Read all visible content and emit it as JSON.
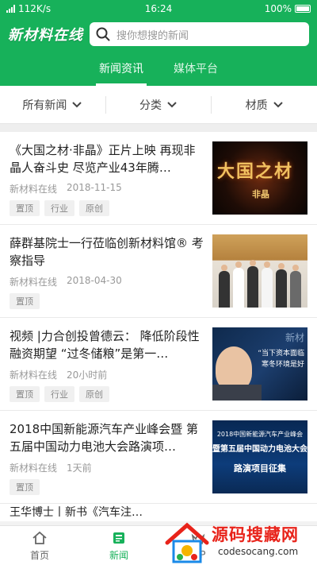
{
  "status": {
    "left": "112K/s",
    "time": "16:24",
    "battery": "100%"
  },
  "header": {
    "logo": "新材料在线",
    "search_placeholder": "搜你想搜的新闻"
  },
  "tabs": [
    {
      "label": "新闻资讯",
      "active": true
    },
    {
      "label": "媒体平台",
      "active": false
    }
  ],
  "filters": [
    {
      "label": "所有新闻"
    },
    {
      "label": "分类"
    },
    {
      "label": "材质"
    }
  ],
  "articles": [
    {
      "title": "《大国之材·非晶》正片上映 再现非晶人奋斗史 尽览产业43年腾…",
      "source": "新材料在线",
      "date": "2018-11-15",
      "tags": [
        "置顶",
        "行业",
        "原创"
      ],
      "thumb": {
        "big": "大国之材",
        "small": "非晶"
      }
    },
    {
      "title": "薛群基院士一行莅临创新材料馆® 考察指导",
      "source": "新材料在线",
      "date": "2018-04-30",
      "tags": [
        "置顶"
      ]
    },
    {
      "title": "视频 |力合创投曾德云：  降低阶段性融资期望 “过冬储粮”是第一…",
      "source": "新材料在线",
      "date": "20小时前",
      "tags": [
        "置顶",
        "行业",
        "原创"
      ],
      "thumb": {
        "wm": "新材",
        "cap1": "“当下资本面临",
        "cap2": "寒冬环境是好"
      }
    },
    {
      "title": "2018中国新能源汽车产业峰会暨 第五届中国动力电池大会路演项…",
      "source": "新材料在线",
      "date": "1天前",
      "tags": [
        "置顶"
      ],
      "thumb": {
        "l1": "2018中国新能源汽车产业峰会",
        "l2": "暨第五届中国动力电池大会",
        "l3": "路演项目征集"
      }
    }
  ],
  "partial_title": "王华博士丨新书《汽车注…",
  "bottom_nav": [
    {
      "label": "首页"
    },
    {
      "label": "新闻",
      "active": true
    },
    {
      "label": "VIP"
    }
  ],
  "watermark": {
    "title": "源码搜藏网",
    "url": "codesocang.com"
  },
  "colors": {
    "brand": "#17b15a"
  }
}
